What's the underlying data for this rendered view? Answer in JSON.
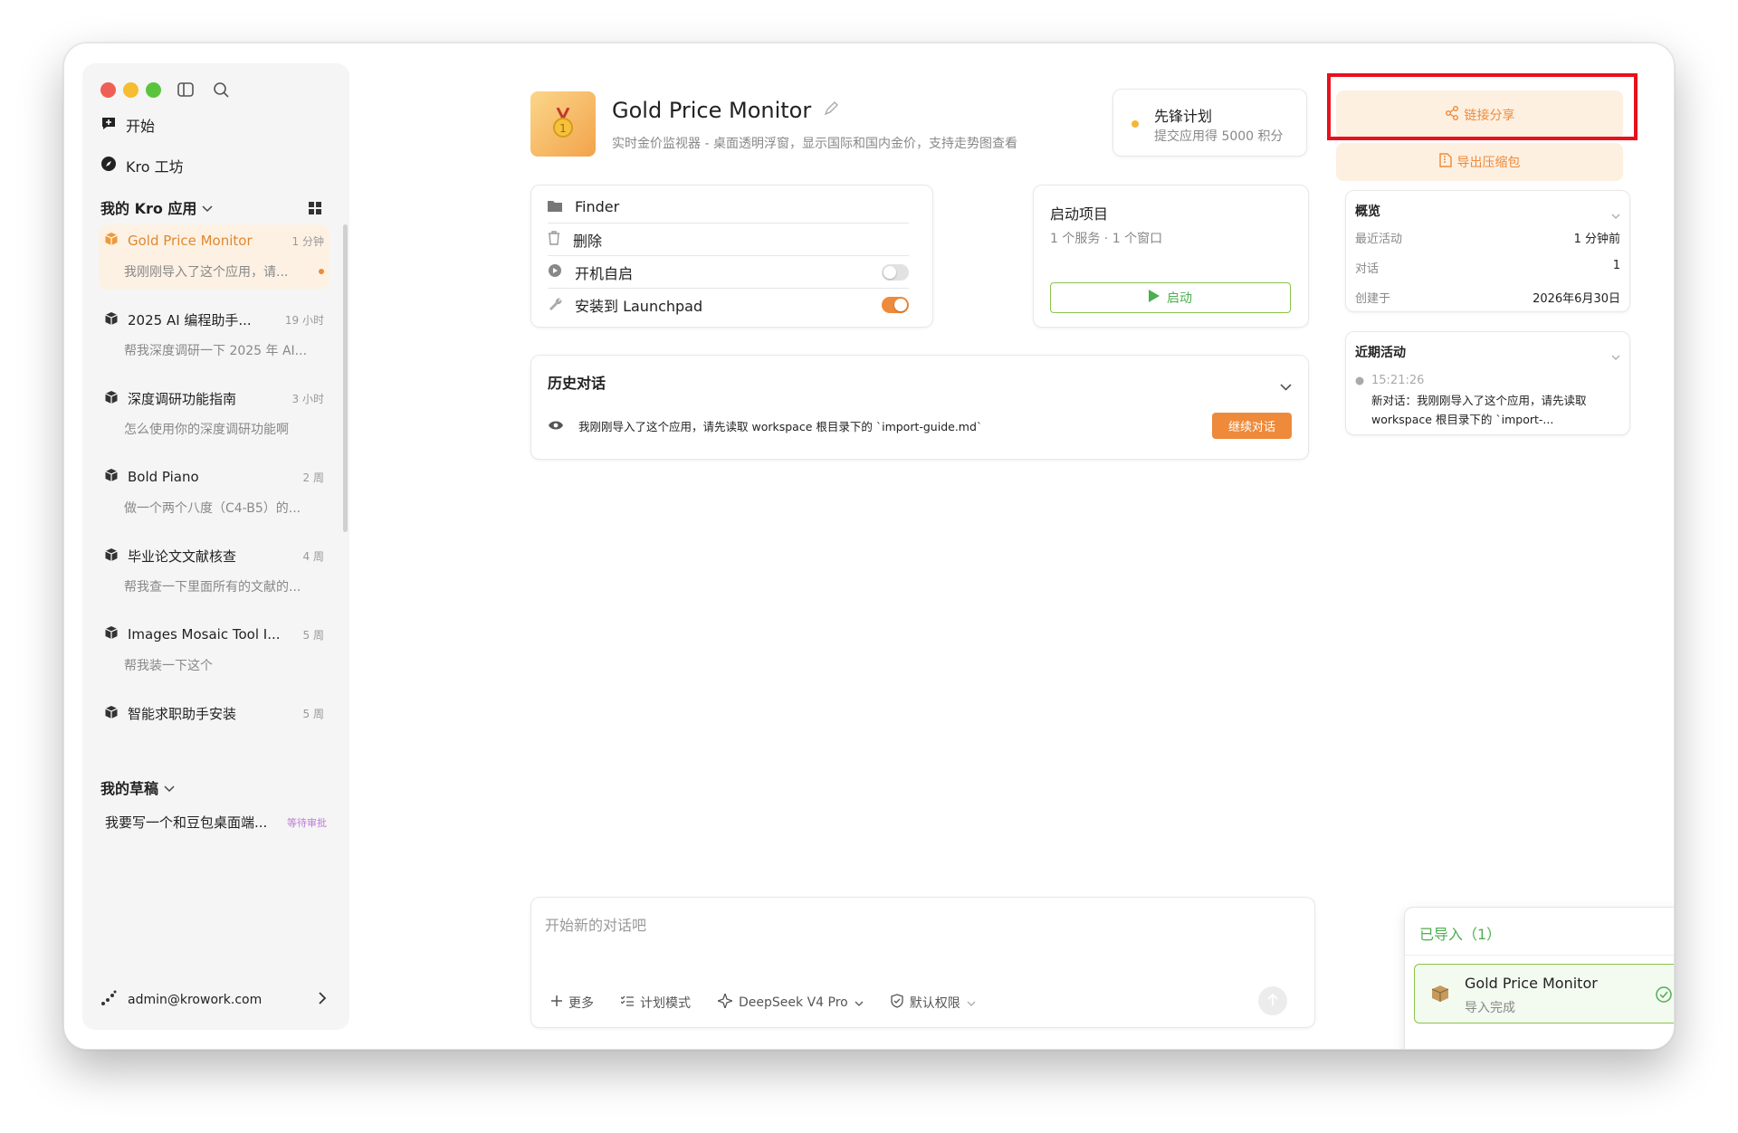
{
  "window": {
    "traffic": [
      "#ee5f57",
      "#f5bd2f",
      "#5bc43f"
    ]
  },
  "sidebar": {
    "nav": [
      {
        "label": "开始",
        "icon": "chat-plus-icon"
      },
      {
        "label": "Kro 工坊",
        "icon": "compass-icon"
      }
    ],
    "apps_title": "我的 Kro 应用",
    "apps": [
      {
        "name": "Gold Price Monitor",
        "time": "1 分钟",
        "sub": "我刚刚导入了这个应用，请...",
        "active": true,
        "unread": true
      },
      {
        "name": "2025 AI 编程助手...",
        "time": "19 小时",
        "sub": "帮我深度调研一下 2025 年 AI..."
      },
      {
        "name": "深度调研功能指南",
        "time": "3 小时",
        "sub": "怎么使用你的深度调研功能啊"
      },
      {
        "name": "Bold Piano",
        "time": "2 周",
        "sub": "做一个两个八度（C4-B5）的..."
      },
      {
        "name": "毕业论文文献核查",
        "time": "4 周",
        "sub": "帮我查一下里面所有的文献的..."
      },
      {
        "name": "Images Mosaic Tool I...",
        "time": "5 周",
        "sub": "帮我装一下这个"
      },
      {
        "name": "智能求职助手安装",
        "time": "5 周",
        "sub": ""
      }
    ],
    "drafts_title": "我的草稿",
    "drafts": [
      {
        "name": "我要写一个和豆包桌面端...",
        "status": "等待审批"
      }
    ],
    "user": "admin@krowork.com"
  },
  "header": {
    "title": "Gold Price Monitor",
    "subtitle": "实时金价监视器 - 桌面透明浮窗，显示国际和国内金价，支持走势图查看"
  },
  "pioneer": {
    "title": "先锋计划",
    "sub": "提交应用得 5000 积分"
  },
  "actions": {
    "share": "链接分享",
    "export": "导出压缩包"
  },
  "options": [
    {
      "label": "Finder",
      "icon": "folder-icon"
    },
    {
      "label": "删除",
      "icon": "trash-icon"
    },
    {
      "label": "开机自启",
      "icon": "play-circle-icon",
      "toggle": false
    },
    {
      "label": "安装到 Launchpad",
      "icon": "wrench-icon",
      "toggle": true
    }
  ],
  "launch": {
    "title": "启动项目",
    "sub": "1 个服务 · 1 个窗口",
    "button": "启动"
  },
  "history": {
    "title": "历史对话",
    "item": "我刚刚导入了这个应用，请先读取 workspace 根目录下的 `import-guide.md`",
    "button": "继续对话"
  },
  "overview": {
    "title": "概览",
    "rows": [
      {
        "k": "最近活动",
        "v": "1 分钟前"
      },
      {
        "k": "对话",
        "v": "1"
      },
      {
        "k": "创建于",
        "v": "2026年6月30日"
      }
    ]
  },
  "recent": {
    "title": "近期活动",
    "time": "15:21:26",
    "text1": "新对话：我刚刚导入了这个应用，请先读取",
    "text2": "workspace 根目录下的 `import-..."
  },
  "composer": {
    "placeholder": "开始新的对话吧",
    "more": "更多",
    "plan": "计划模式",
    "model": "DeepSeek V4 Pro",
    "perm": "默认权限"
  },
  "imported": {
    "title": "已导入（1）",
    "name": "Gold Price Monitor",
    "status": "导入完成"
  },
  "colors": {
    "accent": "#ee8a3a",
    "green": "#4caf50",
    "highlight": "#e8101c"
  }
}
